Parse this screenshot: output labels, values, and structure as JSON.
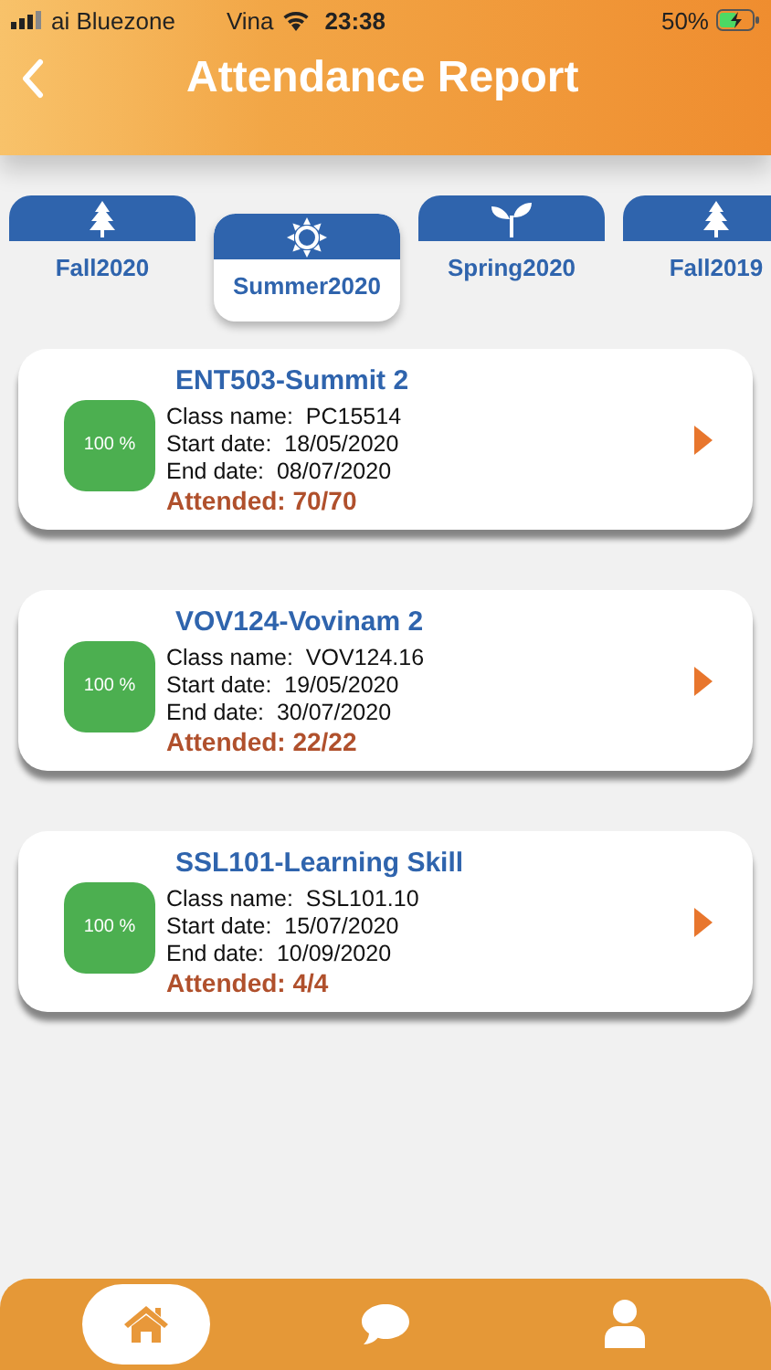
{
  "status_bar": {
    "carrier": "ai Bluezone",
    "carrier_2": "Vina",
    "time": "23:38",
    "battery": "50%"
  },
  "header": {
    "title": "Attendance Report"
  },
  "tabs": [
    {
      "label": "Fall2020",
      "kind": "fall",
      "selected": false
    },
    {
      "label": "Summer2020",
      "kind": "summer",
      "selected": true
    },
    {
      "label": "Spring2020",
      "kind": "spring",
      "selected": false
    },
    {
      "label": "Fall2019",
      "kind": "fall",
      "selected": false
    }
  ],
  "courses": [
    {
      "title": "ENT503-Summit 2",
      "percent": "100 %",
      "class_name": "Class name:  PC15514",
      "start_date": "Start date:  18/05/2020",
      "end_date": "End date:  08/07/2020",
      "attended": "Attended: 70/70"
    },
    {
      "title": "VOV124-Vovinam 2",
      "percent": "100 %",
      "class_name": "Class name:  VOV124.16",
      "start_date": "Start date:  19/05/2020",
      "end_date": "End date:  30/07/2020",
      "attended": "Attended: 22/22"
    },
    {
      "title": "SSL101-Learning Skill",
      "percent": "100 %",
      "class_name": "Class name:  SSL101.10",
      "start_date": "Start date:  15/07/2020",
      "end_date": "End date:  10/09/2020",
      "attended": "Attended: 4/4"
    }
  ],
  "bottom_nav": [
    {
      "kind": "home",
      "selected": true
    },
    {
      "kind": "chat",
      "selected": false
    },
    {
      "kind": "profile",
      "selected": false
    }
  ]
}
